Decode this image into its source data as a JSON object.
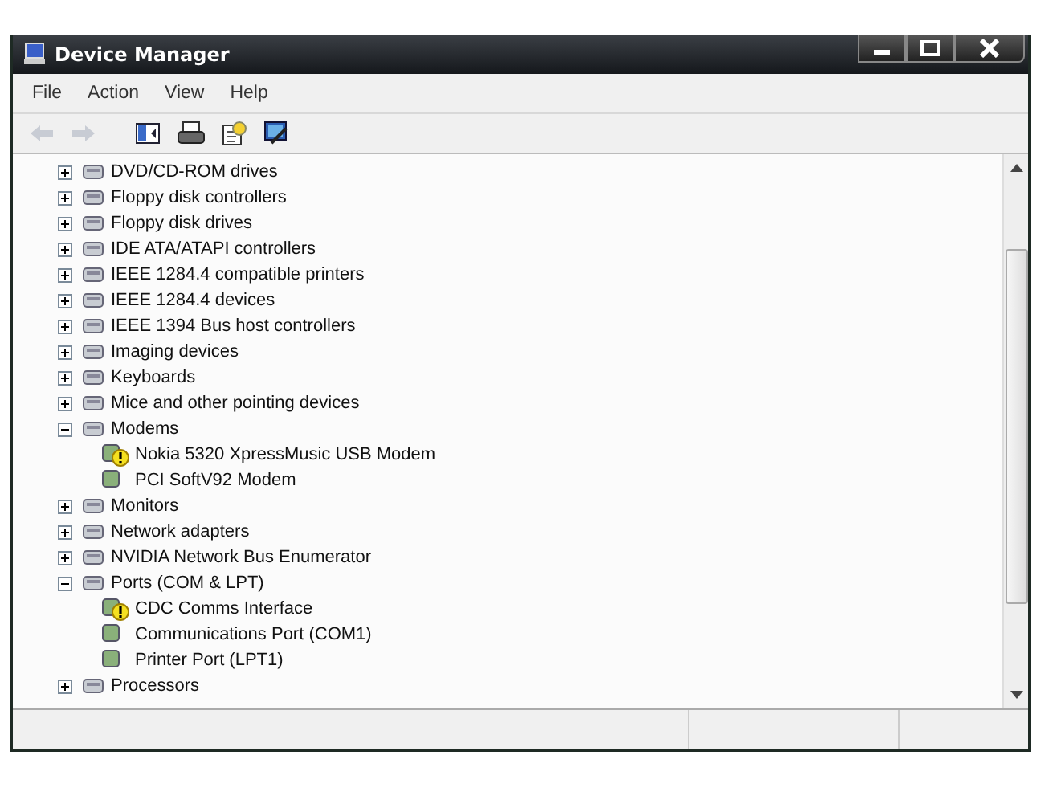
{
  "window": {
    "title": "Device Manager"
  },
  "menu": [
    "File",
    "Action",
    "View",
    "Help"
  ],
  "toolbar": {
    "back_disabled": true,
    "forward_disabled": true
  },
  "tree": [
    {
      "label": "DVD/CD-ROM drives",
      "expanded": false
    },
    {
      "label": "Floppy disk controllers",
      "expanded": false
    },
    {
      "label": "Floppy disk drives",
      "expanded": false
    },
    {
      "label": "IDE ATA/ATAPI controllers",
      "expanded": false
    },
    {
      "label": "IEEE 1284.4 compatible printers",
      "expanded": false
    },
    {
      "label": "IEEE 1284.4 devices",
      "expanded": false
    },
    {
      "label": "IEEE 1394 Bus host controllers",
      "expanded": false
    },
    {
      "label": "Imaging devices",
      "expanded": false
    },
    {
      "label": "Keyboards",
      "expanded": false
    },
    {
      "label": "Mice and other pointing devices",
      "expanded": false
    },
    {
      "label": "Modems",
      "expanded": true,
      "children": [
        {
          "label": "Nokia 5320 XpressMusic USB Modem",
          "warning": true
        },
        {
          "label": "PCI SoftV92 Modem",
          "warning": false
        }
      ]
    },
    {
      "label": "Monitors",
      "expanded": false
    },
    {
      "label": "Network adapters",
      "expanded": false
    },
    {
      "label": "NVIDIA Network Bus Enumerator",
      "expanded": false
    },
    {
      "label": "Ports (COM & LPT)",
      "expanded": true,
      "children": [
        {
          "label": "CDC Comms Interface",
          "warning": true
        },
        {
          "label": "Communications Port (COM1)",
          "warning": false
        },
        {
          "label": "Printer Port (LPT1)",
          "warning": false
        }
      ]
    },
    {
      "label": "Processors",
      "expanded": false
    }
  ]
}
